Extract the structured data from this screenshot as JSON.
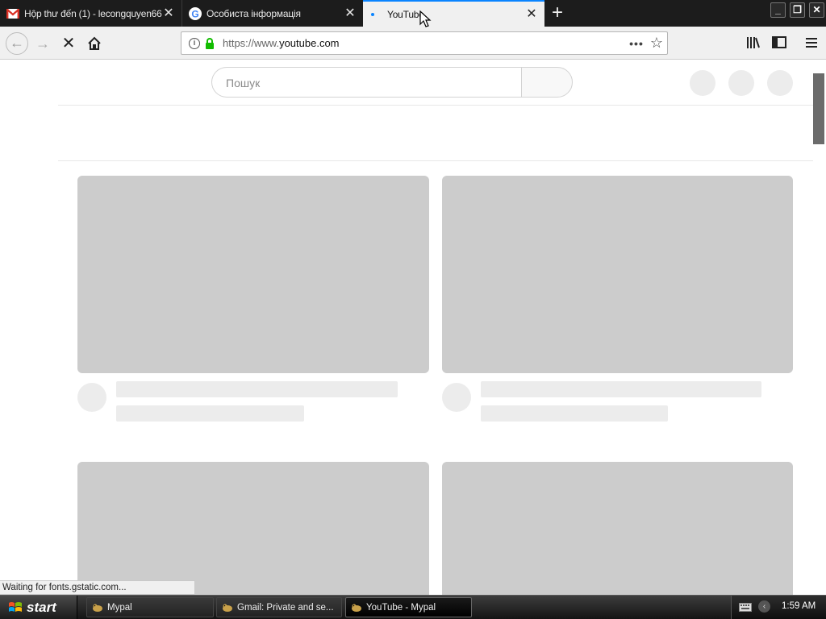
{
  "browser": {
    "tabs": [
      {
        "title": "Hộp thư đến (1) - lecongquyen66",
        "icon": "gmail-icon",
        "active": false
      },
      {
        "title": "Особиста інформація",
        "icon": "google-icon",
        "active": false
      },
      {
        "title": "YouTube",
        "icon": "loading-dot-icon",
        "active": true
      }
    ],
    "url_scheme": "https://www.",
    "url_host": "youtube.com",
    "status_text": "Waiting for fonts.gstatic.com..."
  },
  "page": {
    "search_placeholder": "Пошук"
  },
  "taskbar": {
    "start_label": "start",
    "tasks": [
      {
        "label": "Mypal"
      },
      {
        "label": "Gmail: Private and se..."
      },
      {
        "label": "YouTube - Mypal"
      }
    ],
    "clock": "1:59 AM"
  },
  "colors": {
    "accent": "#0a84ff",
    "skeleton_thumb": "#cccccc",
    "skeleton_text": "#ececec",
    "lock_green": "#12bc00"
  }
}
